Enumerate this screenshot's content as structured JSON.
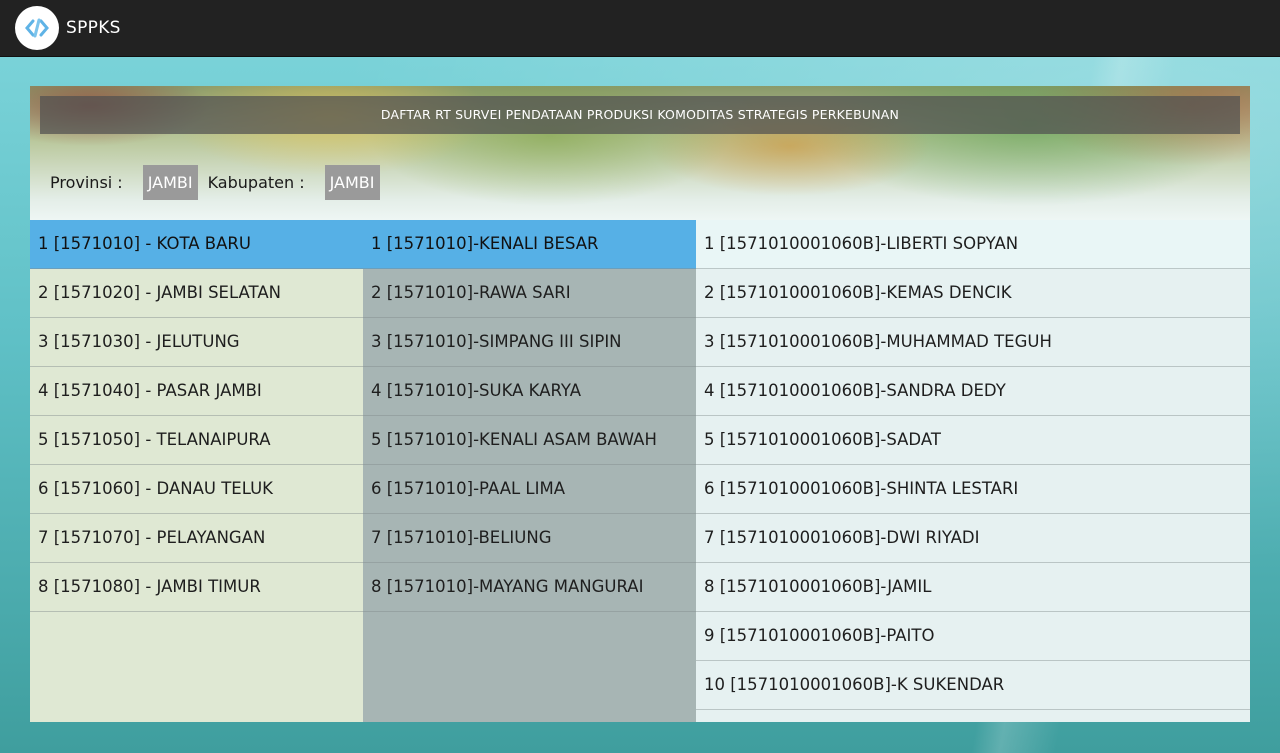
{
  "app": {
    "title": "SPPKS",
    "logo_icon": "code-link-logo-icon"
  },
  "banner": {
    "title": "DAFTAR RT SURVEI PENDATAAN PRODUKSI KOMODITAS STRATEGIS PERKEBUNAN"
  },
  "filters": {
    "provinsi_label": "Provinsi :",
    "provinsi_value": "JAMBI",
    "kabupaten_label": "Kabupaten :",
    "kabupaten_value": "JAMBI"
  },
  "kecamatan": [
    "1 [1571010] - KOTA BARU",
    "2 [1571020] - JAMBI SELATAN",
    "3 [1571030] - JELUTUNG",
    "4 [1571040] - PASAR JAMBI",
    "5 [1571050] - TELANAIPURA",
    "6 [1571060] - DANAU TELUK",
    "7 [1571070] - PELAYANGAN",
    "8 [1571080] - JAMBI TIMUR"
  ],
  "desa": [
    "1 [1571010]-KENALI BESAR",
    "2 [1571010]-RAWA SARI",
    "3 [1571010]-SIMPANG III SIPIN",
    "4 [1571010]-SUKA KARYA",
    "5 [1571010]-KENALI ASAM BAWAH",
    "6 [1571010]-PAAL LIMA",
    "7 [1571010]-BELIUNG",
    "8 [1571010]-MAYANG MANGURAI"
  ],
  "rumah_tangga": [
    "1 [1571010001060B]-LIBERTI SOPYAN",
    "2 [1571010001060B]-KEMAS DENCIK",
    "3 [1571010001060B]-MUHAMMAD TEGUH",
    "4 [1571010001060B]-SANDRA DEDY",
    "5 [1571010001060B]-SADAT",
    "6 [1571010001060B]-SHINTA LESTARI",
    "7 [1571010001060B]-DWI RIYADI",
    "8 [1571010001060B]-JAMIL",
    "9 [1571010001060B]-PAITO",
    "10 [1571010001060B]-K SUKENDAR"
  ],
  "colors": {
    "selected": "#56b0e6",
    "appbar": "#222222",
    "chip": "#9a9a9a"
  }
}
